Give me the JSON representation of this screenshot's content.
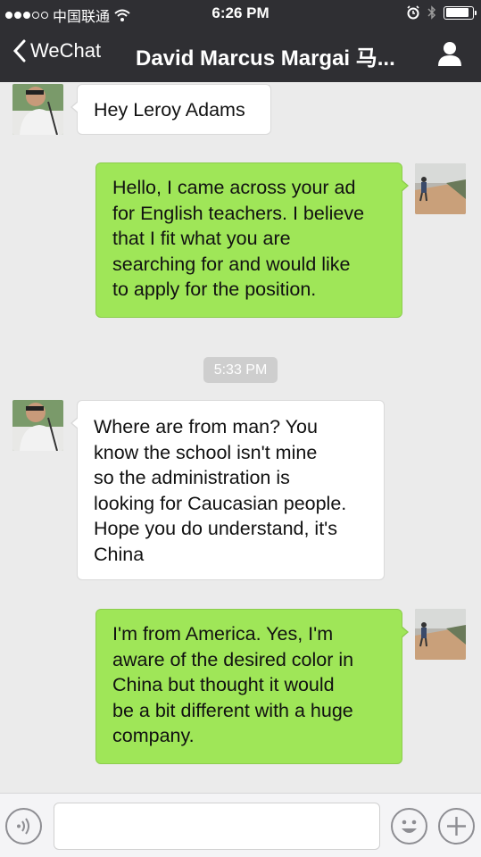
{
  "status_bar": {
    "carrier": "中国联通",
    "time": "6:26 PM",
    "signal_bars_filled": 3,
    "signal_bars_total": 5,
    "battery_level": 0.9,
    "icons": [
      "signal-icon",
      "wifi-icon",
      "alarm-icon",
      "bluetooth-icon",
      "battery-icon"
    ]
  },
  "nav": {
    "back_label": "WeChat",
    "title": "David Marcus Margai 马...",
    "back_icon": "chevron-left-icon",
    "profile_icon": "person-icon"
  },
  "messages": [
    {
      "direction": "incoming",
      "text": "Hey Leroy Adams"
    },
    {
      "direction": "outgoing",
      "text": "Hello, I came across your ad\nfor English teachers. I believe\nthat I fit what you are\nsearching for and would like\nto apply for the position."
    },
    {
      "direction": "incoming",
      "text": "Where are from man? You\nknow the school isn't mine\nso the administration is\nlooking for Caucasian people.\nHope you do understand, it's\nChina"
    },
    {
      "direction": "outgoing",
      "text": "I'm from America. Yes, I'm\naware of the desired color in\nChina but thought it would\nbe a bit different with a huge\ncompany."
    }
  ],
  "timestamp": "5:33 PM",
  "input_bar": {
    "placeholder": "",
    "voice_icon": "voice-icon",
    "emoji_icon": "emoji-icon",
    "plus_icon": "plus-icon"
  },
  "colors": {
    "nav_background": "#2f2f33",
    "chat_background": "#ebebeb",
    "outgoing_bubble": "#9fe658",
    "incoming_bubble": "#ffffff",
    "timestamp_badge": "#cecece"
  }
}
